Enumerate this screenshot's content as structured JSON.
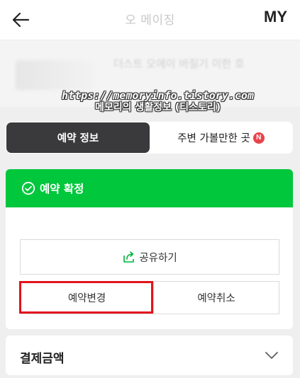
{
  "header": {
    "title": "오 메이징",
    "my_label": "MY"
  },
  "hotel_preview": {
    "name": "더스트 오에이 바질기 이한 호"
  },
  "watermark": {
    "line1": "https://memoryinfo.tistory.com",
    "line2": "메모리의 생활정보 (티스토리)"
  },
  "tabs": [
    {
      "label": "예약 정보",
      "active": true
    },
    {
      "label": "주변 가볼만한 곳",
      "badge": "N",
      "active": false
    }
  ],
  "status": {
    "label": "예약 확정",
    "color": "#00c73c"
  },
  "actions": {
    "share_label": "공유하기",
    "change_label": "예약변경",
    "cancel_label": "예약취소"
  },
  "payment": {
    "label": "결제금액"
  },
  "colors": {
    "accent_green": "#00c73c",
    "highlight_red": "#e1141e",
    "tab_active_bg": "#3a3a3c",
    "badge_red": "#e8434a"
  }
}
